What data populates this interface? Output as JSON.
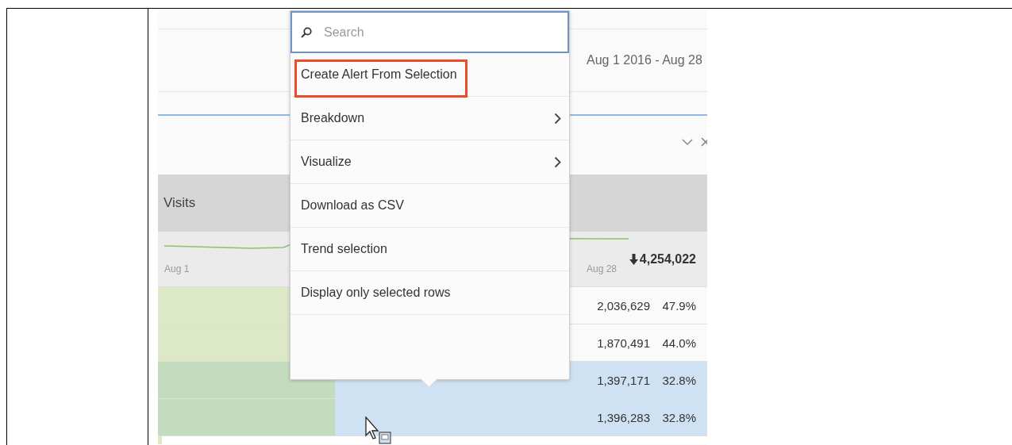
{
  "header": {
    "date_range": "Aug 1 2016 - Aug 28"
  },
  "table": {
    "metric": "Visits",
    "summary": {
      "start_label": "Aug 1",
      "end_label": "Aug 28",
      "total": "4,254,022"
    },
    "rows": [
      {
        "value": "2,036,629",
        "percent": "47.9%",
        "selected": false
      },
      {
        "value": "1,870,491",
        "percent": "44.0%",
        "selected": false
      },
      {
        "value": "1,397,171",
        "percent": "32.8%",
        "selected": true
      },
      {
        "value": "1,396,283",
        "percent": "32.8%",
        "selected": true
      }
    ]
  },
  "context_menu": {
    "search": {
      "placeholder": "Search"
    },
    "items": [
      {
        "label": "Create Alert From Selection",
        "submenu": false,
        "highlighted": true
      },
      {
        "label": "Breakdown",
        "submenu": true,
        "highlighted": false
      },
      {
        "label": "Visualize",
        "submenu": true,
        "highlighted": false
      },
      {
        "label": "Download as CSV",
        "submenu": false,
        "highlighted": false
      },
      {
        "label": "Trend selection",
        "submenu": false,
        "highlighted": false
      },
      {
        "label": "Display only selected rows",
        "submenu": false,
        "highlighted": false
      }
    ]
  }
}
